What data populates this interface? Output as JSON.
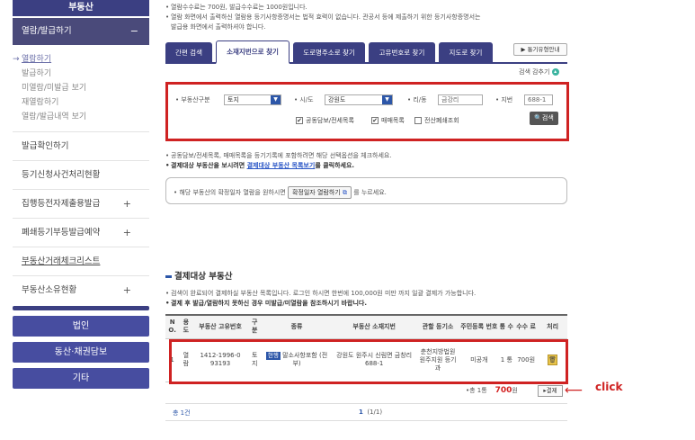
{
  "sidebar": {
    "title": "부동산",
    "active_menu": "열람/발급하기",
    "active_toggle": "−",
    "sub_items": [
      "열람하기",
      "발급하기",
      "미열람/미발급 보기",
      "재열람하기",
      "열람/발급내역 보기"
    ],
    "items": [
      {
        "label": "발급확인하기",
        "toggle": ""
      },
      {
        "label": "등기신청사건처리현황",
        "toggle": ""
      },
      {
        "label": "집행등전자제출용발급",
        "toggle": "+"
      },
      {
        "label": "폐쇄등기부등발급예약",
        "toggle": "+"
      },
      {
        "label": "부동산거래체크리스트",
        "toggle": ""
      },
      {
        "label": "부동산소유현황",
        "toggle": "+"
      }
    ],
    "buttons": [
      "법인",
      "동산·채권담보",
      "기타"
    ]
  },
  "notes_top": [
    "열람수수료는 700원, 발급수수료는 1000원입니다.",
    "열람 화면에서 출력하신 열람용 등기사항증명서는 법적 효력이 없습니다. 관공서 등에 제출하기 위한 등기사항증명서는",
    "발급용 화면에서 출력하셔야 합니다."
  ],
  "tabs": [
    "간편 검색",
    "소재지번으로 찾기",
    "도로명주소로 찾기",
    "고유번호로 찾기",
    "지도로 찾기"
  ],
  "guide_button": "▶ 통기유형안내",
  "search_close": "검색 감추기",
  "search": {
    "type_label": "부동산구분",
    "type_value": "토지",
    "sido_label": "시/도",
    "sido_value": "강원도",
    "ri_label": "리/동",
    "ri_value": "금강리",
    "jibun_label": "지번",
    "jibun_value": "688-1",
    "checks": [
      {
        "label": "공동담보/전세목록",
        "checked": true
      },
      {
        "label": "매매목록",
        "checked": true
      },
      {
        "label": "전산폐쇄조회",
        "checked": false
      }
    ],
    "search_button": "검색"
  },
  "notes_mid": {
    "line1": "공동담보/전세목록, 매매목록을 등기기록에 포함하려면 해당 선택옵션을 체크하세요.",
    "line2_pre": "결제대상 부동산을 보시려면 ",
    "line2_link": "결제대상 부동산 목록보기",
    "line2_post": "를 클릭하세요."
  },
  "info_box": {
    "pre": "해당 부동산의 확정일자 열람을 원하시면",
    "button": "확정일자 열람하기",
    "post": "를 누르세요."
  },
  "section_title": "결제대상 부동산",
  "notes_sec": [
    "검색이 완료되어 결제하실 부동산 목록입니다. 로그인 하시면 한번에 100,000원 미만 까지 일괄 결제가 가능합니다.",
    "결제 후 발급/열람하지 못하신 경우 미발급/미열람을 참조하시기 바랍니다."
  ],
  "table": {
    "headers": [
      "N O.",
      "용 도",
      "부동산 고유번호",
      "구 분",
      "종류",
      "부동산 소재지번",
      "관할 등기소",
      "주민등록 번호",
      "통 수",
      "수수 료",
      "처리"
    ],
    "row": {
      "no": "1",
      "use": "열 람",
      "id": "1412-1996-0 93193",
      "div": "토 지",
      "kind_badge": "현행",
      "kind": "말소사항포함 (전부)",
      "addr": "강원도 원주시 신림면 금창리 688-1",
      "office": "춘천지방법원 원주지원 등기과",
      "rrn": "미공개",
      "count": "1 통",
      "fee": "700원",
      "action": "🗑"
    }
  },
  "total_label": "•총 1통",
  "total_amount": "700",
  "total_unit": "원",
  "pay_button": "결제",
  "footer": {
    "count": "총 1건",
    "page_current": "1",
    "page_total": "(1/1)"
  },
  "annotation": {
    "arrow": "⟵",
    "text": "click"
  }
}
